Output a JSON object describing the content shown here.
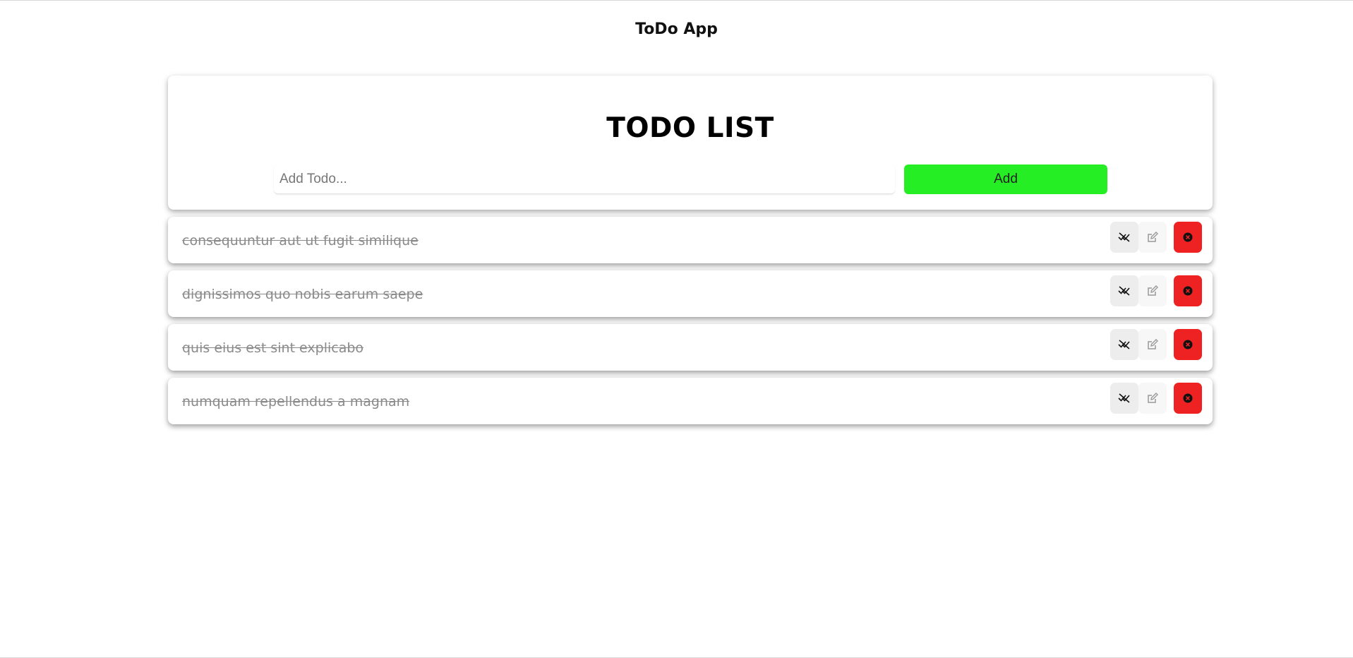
{
  "app": {
    "title": "ToDo App"
  },
  "header": {
    "list_title": "TODO LIST",
    "input_placeholder": "Add Todo...",
    "input_value": "",
    "add_label": "Add"
  },
  "todos": [
    {
      "text": "consequuntur aut ut fugit similique",
      "completed": true
    },
    {
      "text": "dignissimos quo nobis earum saepe",
      "completed": true
    },
    {
      "text": "quis eius est sint explicabo",
      "completed": true
    },
    {
      "text": "numquam repellendus a magnam",
      "completed": true
    }
  ],
  "icons": {
    "toggle": "uncheck-all-icon",
    "edit": "edit-icon",
    "delete": "close-circle-icon"
  },
  "colors": {
    "add_button": "#25ee25",
    "delete_button": "#ee2222",
    "completed_text": "#8a8a8a"
  }
}
